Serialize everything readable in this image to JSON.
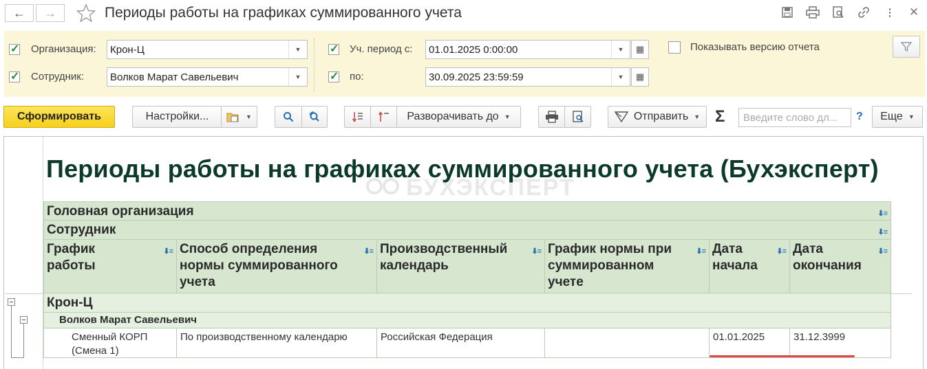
{
  "window": {
    "title": "Периоды работы на графиках суммированного учета"
  },
  "icons": {
    "back": "arrow-left-icon",
    "forward": "arrow-right-icon",
    "favorite": "star-icon",
    "save": "floppy-disk-icon",
    "print": "printer-icon",
    "preview": "print-preview-icon",
    "link": "link-icon",
    "more": "kebab-menu-icon",
    "close": "close-icon"
  },
  "filters": {
    "organization": {
      "label": "Организация:",
      "value": "Крон-Ц",
      "checked": true
    },
    "employee": {
      "label": "Сотрудник:",
      "value": "Волков Марат Савельевич",
      "checked": true
    },
    "period_from": {
      "label": "Уч. период с:",
      "value": "01.01.2025  0:00:00",
      "checked": true
    },
    "period_to": {
      "label": "по:",
      "value": "30.09.2025 23:59:59",
      "checked": true
    },
    "show_version": {
      "label": "Показывать версию отчета",
      "checked": false
    }
  },
  "toolbar": {
    "generate": "Сформировать",
    "settings": "Настройки...",
    "expand_to": "Разворачивать до",
    "send": "Отправить",
    "sum_symbol": "Σ",
    "search_placeholder": "Введите слово дл...",
    "help": "?",
    "more": "Еще"
  },
  "report": {
    "title": "Периоды работы на графиках суммированного учета (Бухэксперт)",
    "watermark": "БУХЭКСПЕРТ",
    "group_headers": [
      "Головная организация",
      "Сотрудник"
    ],
    "columns": [
      {
        "label": "График работы"
      },
      {
        "label": "Способ определения нормы суммированного учета"
      },
      {
        "label": "Производственный календарь"
      },
      {
        "label": "График нормы при суммированном учете"
      },
      {
        "label": "Дата начала"
      },
      {
        "label": "Дата окончания"
      }
    ],
    "groups": [
      {
        "name": "Крон-Ц",
        "employees": [
          {
            "name": "Волков Марат Савельевич",
            "rows": [
              [
                "Сменный КОРП (Смена 1)",
                "По производственному календарю",
                "Российская Федерация",
                "",
                "01.01.2025",
                "31.12.3999"
              ]
            ]
          }
        ]
      }
    ]
  },
  "colors": {
    "accent_button": "#f6cf1c",
    "filter_bg": "#fbf6d8",
    "table_header_bg": "#d6e6cf",
    "report_title": "#0c3a2a",
    "underline": "#e04545"
  }
}
